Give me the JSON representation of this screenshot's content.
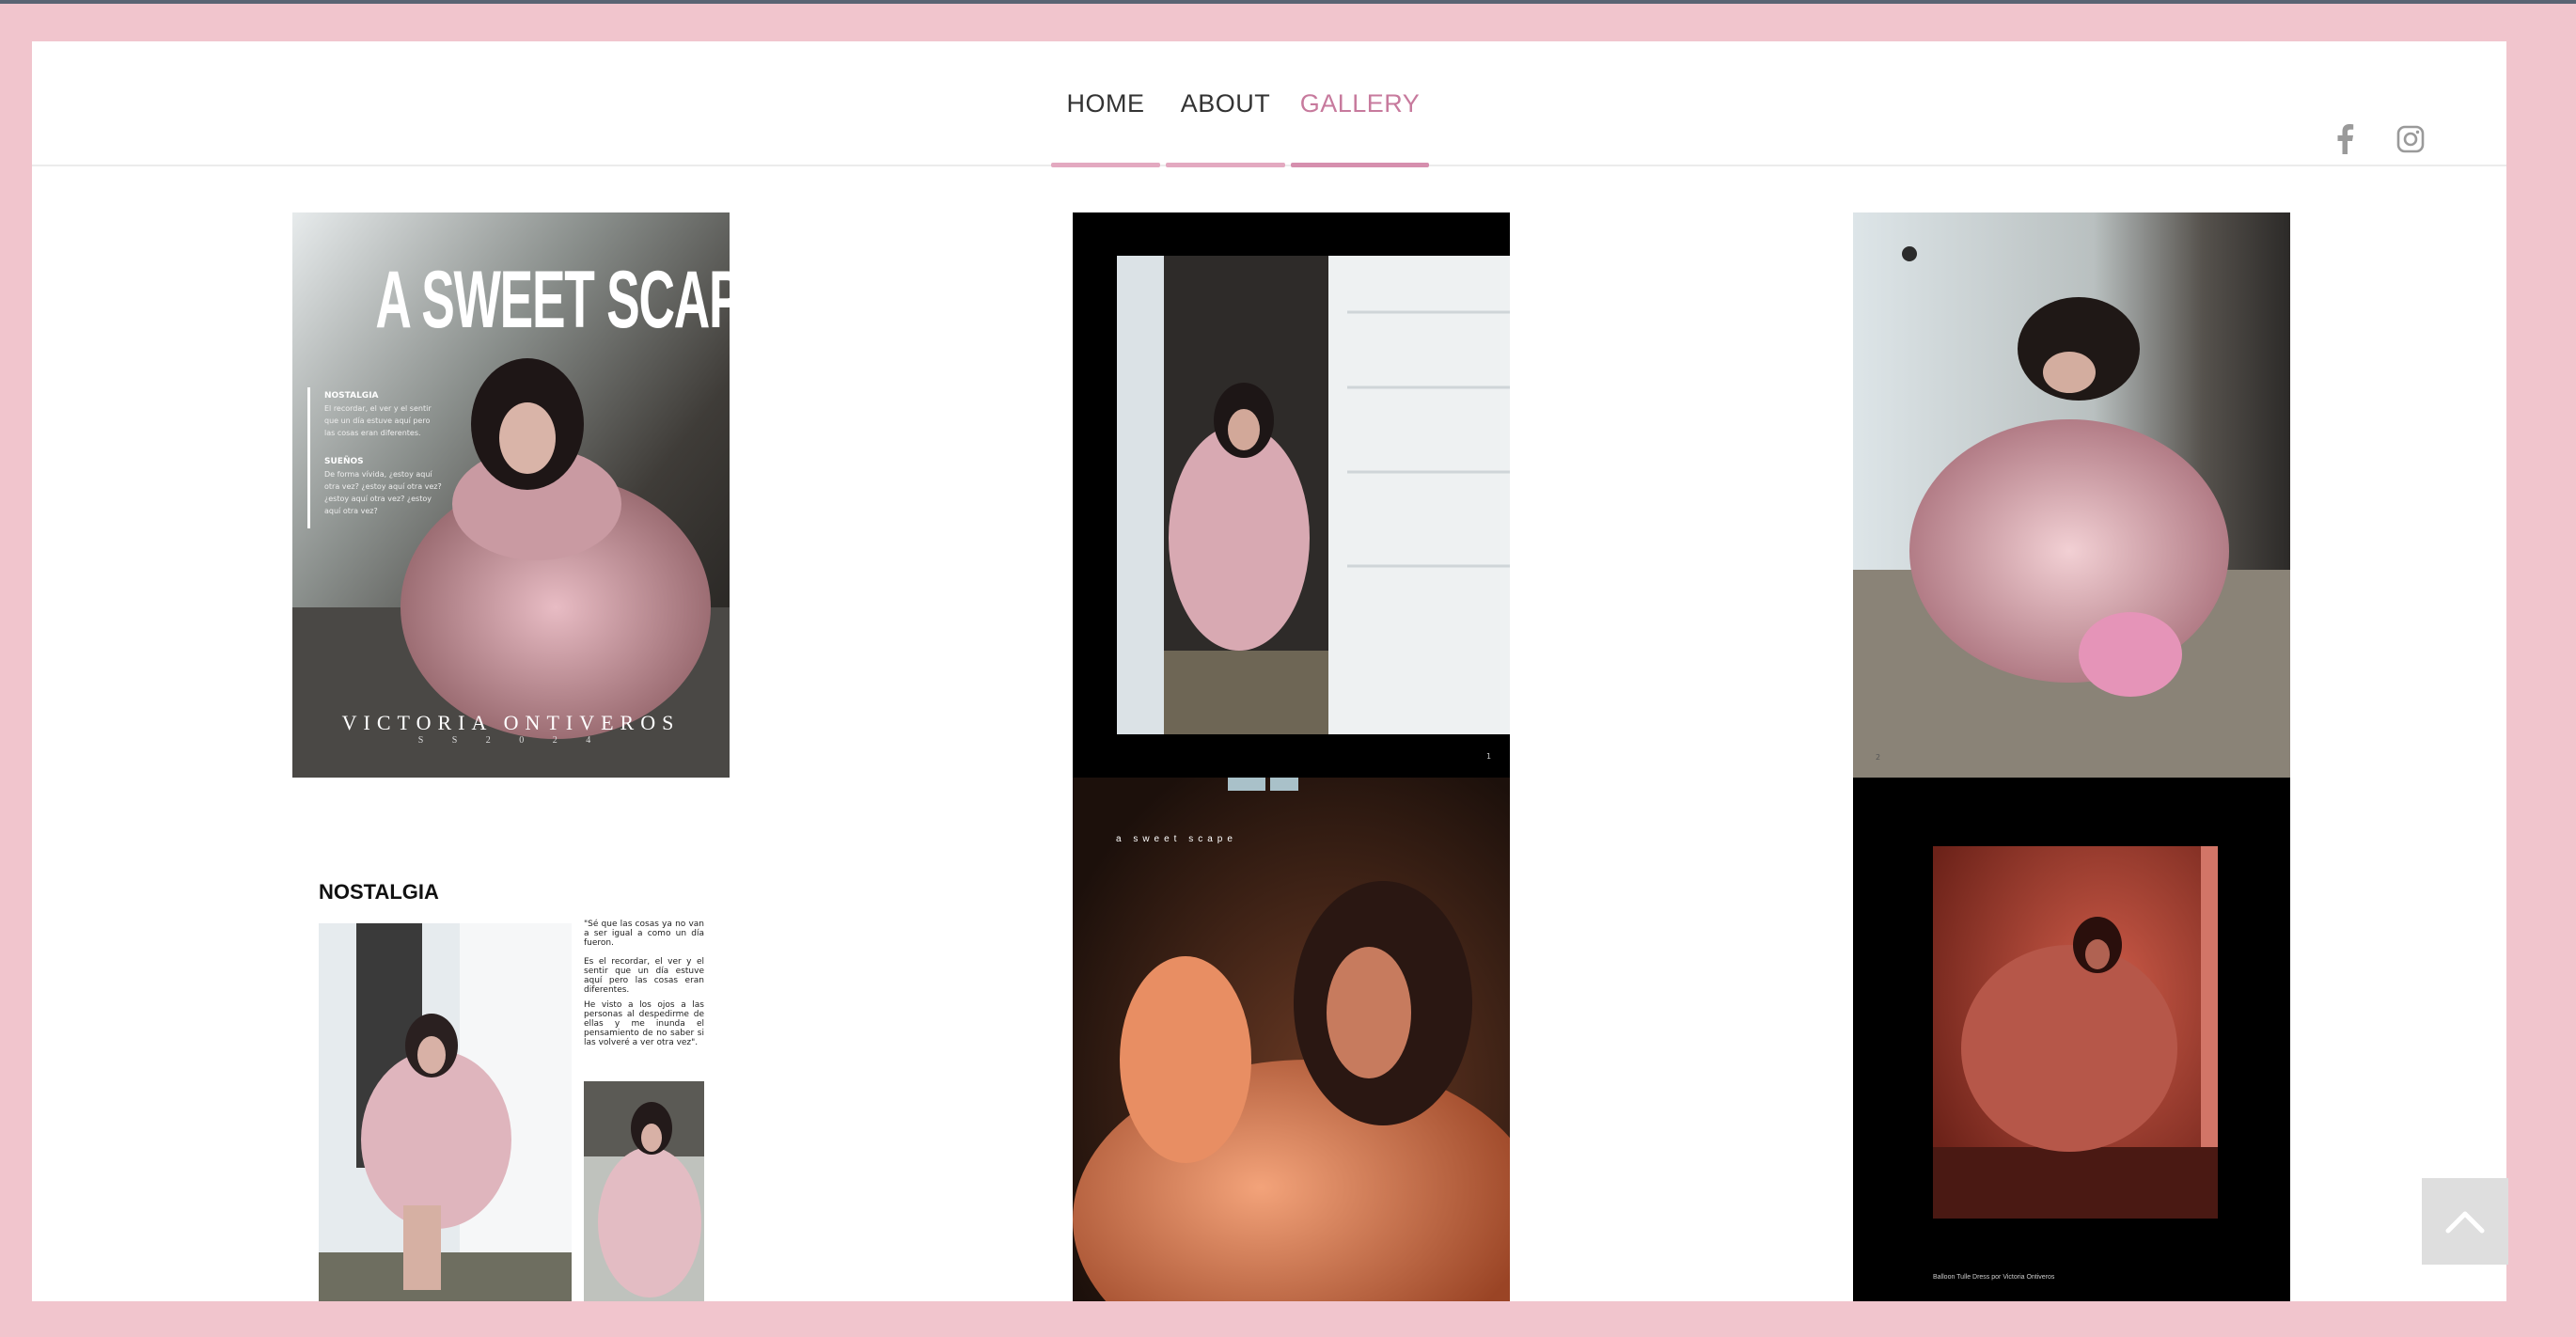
{
  "nav": {
    "items": [
      {
        "label": "HOME"
      },
      {
        "label": "ABOUT"
      },
      {
        "label": "GALLERY"
      }
    ]
  },
  "social": {
    "facebook": "facebook-icon",
    "instagram": "instagram-icon"
  },
  "gallery": {
    "cover": {
      "title": "A SWEET SCAPE",
      "section1_title": "NOSTALGIA",
      "section1_text": "El recordar, el ver y el sentir que un día estuve aquí pero las cosas eran diferentes.",
      "section2_title": "SUEÑOS",
      "section2_text": "De forma vívida, ¿estoy aquí otra vez? ¿estoy aquí otra vez? ¿estoy aquí otra vez? ¿estoy aquí otra vez?",
      "designer": "VICTORIA ONTIVEROS",
      "season": "S S 2 0 2 4"
    },
    "page1": {
      "number": "1"
    },
    "page2": {
      "number": "2"
    },
    "spread": {
      "title": "NOSTALGIA",
      "quote": "\"Sé que las cosas ya no van a ser igual a como un día fueron.",
      "p2": "Es el recordar, el ver y el sentir que un día estuve aquí pero las cosas eran diferentes.",
      "p3": "He visto a los ojos a las personas al despedirme de ellas y me inunda el pensamiento de no saber si las volveré a ver otra vez\"."
    },
    "orange": {
      "caption": "a sweet scape"
    },
    "red": {
      "caption": "Balloon Tulle Dress por Victoria Ontiveros"
    }
  },
  "colors": {
    "accent": "#c77a9d",
    "nav_bar": "#e3a9c0",
    "frame": "#f1c5cd"
  }
}
